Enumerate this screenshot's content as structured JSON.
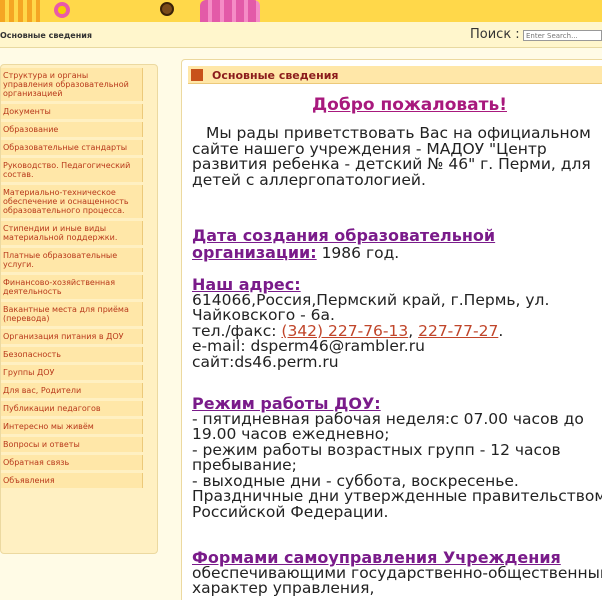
{
  "topbar": {
    "breadcrumb": "Основные сведения",
    "search_label": "Поиск :",
    "search_placeholder": "Enter Search..."
  },
  "sidebar": {
    "items": [
      {
        "label": "Структура и органы управления образовательной организацией"
      },
      {
        "label": "Документы"
      },
      {
        "label": "Образование"
      },
      {
        "label": "Образовательные стандарты"
      },
      {
        "label": "Руководство. Педагогический состав."
      },
      {
        "label": "Материально-техническое обеспечение и оснащенность образовательного процесса."
      },
      {
        "label": "Стипендии и иные виды материальной поддержки."
      },
      {
        "label": "Платные образовательные услуги."
      },
      {
        "label": "Финансово-хозяйственная деятельность"
      },
      {
        "label": "Вакантные места для приёма (перевода)"
      },
      {
        "label": "Организация питания в ДОУ"
      },
      {
        "label": "Безопасность"
      },
      {
        "label": "Группы ДОУ"
      },
      {
        "label": "Для вас, Родители"
      },
      {
        "label": "Публикации педагогов"
      },
      {
        "label": "Интересно мы живём"
      },
      {
        "label": "Вопросы и ответы"
      },
      {
        "label": "Обратная связь"
      },
      {
        "label": "Объявления"
      }
    ]
  },
  "content": {
    "header": "Основные сведения",
    "welcome": "Добро пожаловать!",
    "intro": "Мы рады приветствовать Вас на официальном сайте нашего учреждения  - МАДОУ \"Центр развития ребенка - детский № 46\" г. Перми, для детей с аллергопатологией.",
    "founding_label": "Дата создания образовательной организации:",
    "founding_value": " 1986 год.",
    "address_label": "Наш адрес:",
    "address_line1": "614066,Россия,Пермский край, г.Пермь, ул. Чайковского - 6а.",
    "phone_prefix": "тел./факс: ",
    "phone1": "(342) 227-76-13",
    "phone_sep": ", ",
    "phone2": "227-77-27",
    "phone_suffix": ".",
    "email": "e-mail: dsperm46@rambler.ru",
    "site": "сайт:ds46.perm.ru",
    "schedule_label": "Режим работы ДОУ:",
    "schedule_1": "- пятидневная рабочая неделя:с 07.00 часов до 19.00 часов ежедневно;",
    "schedule_2": "- режим работы возрастных групп - 12 часов пребывание;",
    "schedule_3": "- выходные дни - суббота, воскресенье. Праздничные дни утвержденные правительством Российской Федерации.",
    "governance_label": "Формами самоуправления Учреждения",
    "governance_text": "обеспечивающими государственно-общественный характер управления,"
  },
  "colors": {
    "banner": "#ffd84a",
    "accent_link": "#c0452a",
    "heading_purple": "#7a1b8a",
    "welcome_magenta": "#a8197d"
  }
}
